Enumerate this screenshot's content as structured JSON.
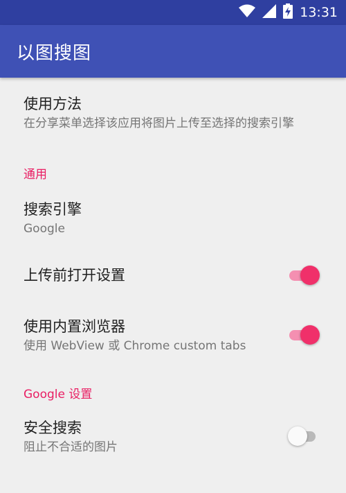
{
  "status_bar": {
    "time": "13:31",
    "icons": [
      "wifi-icon",
      "cell-signal-icon",
      "battery-charging-icon"
    ]
  },
  "app_bar": {
    "title": "以图搜图"
  },
  "settings": {
    "usage": {
      "title": "使用方法",
      "summary": "在分享菜单选择该应用将图片上传至选择的搜索引擎"
    },
    "general": {
      "header": "通用",
      "search_engine": {
        "title": "搜索引擎",
        "summary": "Google"
      },
      "open_settings_before_upload": {
        "title": "上传前打开设置",
        "enabled": true
      },
      "builtin_browser": {
        "title": "使用内置浏览器",
        "summary": "使用 WebView 或 Chrome custom tabs",
        "enabled": true
      }
    },
    "google": {
      "header": "Google 设置",
      "safe_search": {
        "title": "安全搜索",
        "summary": "阻止不合适的图片",
        "enabled": false
      }
    }
  },
  "colors": {
    "status_bar": "#2f3fa0",
    "app_bar": "#3f51b5",
    "accent": "#e91e63",
    "background": "#efefef"
  }
}
